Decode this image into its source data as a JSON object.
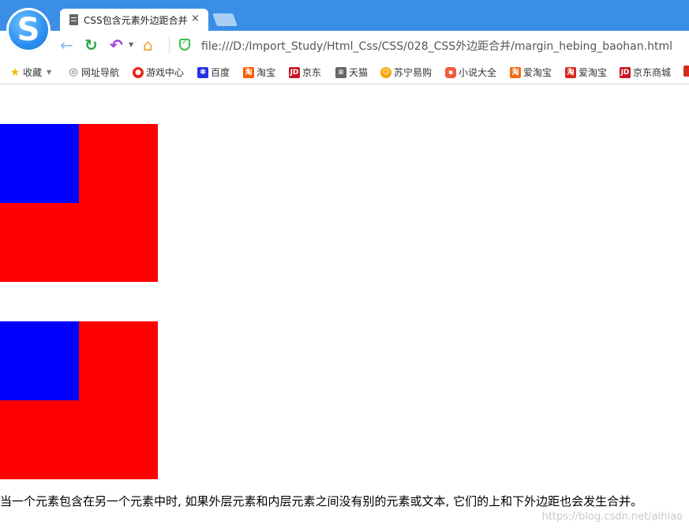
{
  "browser": {
    "tab_title": "CSS包含元素外边距合并",
    "tab_close": "×",
    "address": "file:///D:/Import_Study/Html_Css/CSS/028_CSS外边距合并/margin_hebing_baohan.html",
    "logo_letter": "S"
  },
  "bookmarks": [
    {
      "label": "收藏",
      "icon": "star-icon"
    },
    {
      "label": "网址导航",
      "icon": "globe-icon"
    },
    {
      "label": "游戏中心",
      "icon": "game-icon"
    },
    {
      "label": "百度",
      "icon": "baidu-icon"
    },
    {
      "label": "淘宝",
      "icon": "taobao-icon"
    },
    {
      "label": "京东",
      "icon": "jd-icon"
    },
    {
      "label": "天猫",
      "icon": "tmall-icon"
    },
    {
      "label": "苏宁易购",
      "icon": "suning-icon"
    },
    {
      "label": "小说大全",
      "icon": "novel-icon"
    },
    {
      "label": "爱淘宝",
      "icon": "aitaobao-icon"
    },
    {
      "label": "爱淘宝",
      "icon": "aitaobao-icon"
    },
    {
      "label": "京东商城",
      "icon": "jd-icon"
    }
  ],
  "page": {
    "outer_color": "#ff0000",
    "inner_color": "#0000ff",
    "caption": "当一个元素包含在另一个元素中时, 如果外层元素和内层元素之间没有别的元素或文本, 它们的上和下外边距也会发生合并。",
    "watermark": "https://blog.csdn.net/aihiao"
  }
}
